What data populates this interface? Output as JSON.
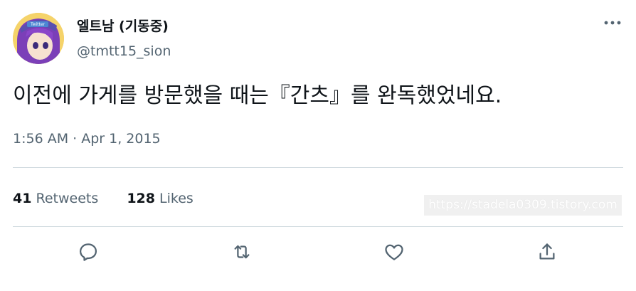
{
  "tweet": {
    "display_name": "엘트남 (기동중)",
    "handle": "@tmtt15_sion",
    "text": "이전에 가게를 방문했을 때는『간츠』를 완독했었네요.",
    "timestamp": "1:56 AM · Apr 1, 2015",
    "retweets": {
      "count": "41",
      "label": "Retweets"
    },
    "likes": {
      "count": "128",
      "label": "Likes"
    }
  },
  "avatar": {
    "badge_text": "Twitter"
  },
  "watermark": "https://stadela0309.tistory.com",
  "icons": {
    "more": "more-icon",
    "reply": "reply-icon",
    "retweet": "retweet-icon",
    "like": "like-icon",
    "share": "share-icon"
  },
  "colors": {
    "text": "#0f1419",
    "secondary": "#536471",
    "divider": "#cfd9de",
    "avatar_hair": "#7b3fb8",
    "avatar_cap": "#5a4fb0"
  }
}
